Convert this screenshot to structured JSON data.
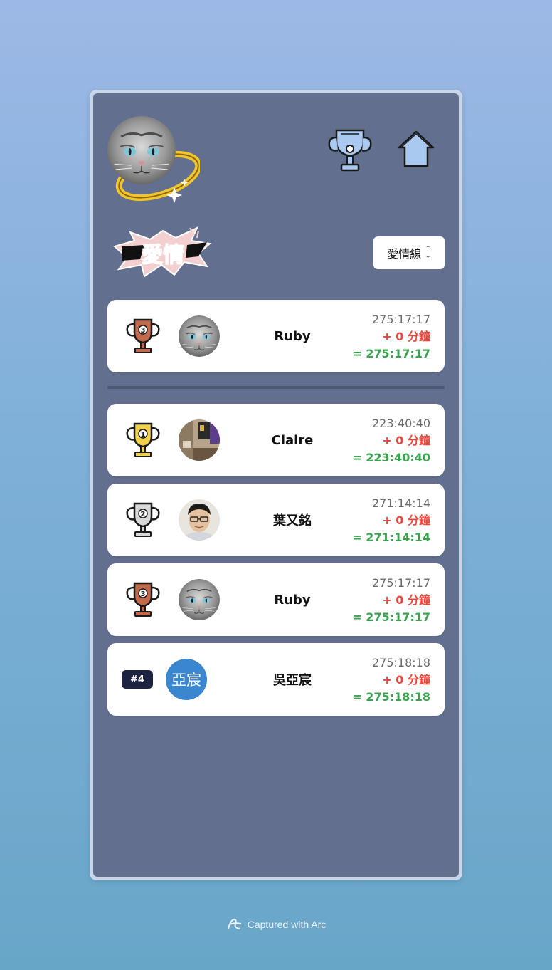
{
  "header": {
    "avatar_icon": "cat-avatar-with-halo",
    "trophy_button_icon": "trophy-icon",
    "home_button_icon": "home-icon",
    "logo_icon": "love-line-title-graphic"
  },
  "selector": {
    "selected": "愛情線"
  },
  "pinned": {
    "rank_icon": "bronze-trophy-3-icon",
    "name": "Ruby",
    "time": "275:17:17",
    "bonus": "+ 0 分鐘",
    "total": "= 275:17:17"
  },
  "leaderboard": [
    {
      "rank_icon": "gold-trophy-1-icon",
      "name": "Claire",
      "time": "223:40:40",
      "bonus": "+ 0 分鐘",
      "total": "= 223:40:40"
    },
    {
      "rank_icon": "silver-trophy-2-icon",
      "name": "葉又銘",
      "time": "271:14:14",
      "bonus": "+ 0 分鐘",
      "total": "= 271:14:14"
    },
    {
      "rank_icon": "bronze-trophy-3-icon",
      "name": "Ruby",
      "time": "275:17:17",
      "bonus": "+ 0 分鐘",
      "total": "= 275:17:17"
    },
    {
      "rank_label": "#4",
      "avatar_text": "亞宸",
      "name": "吳亞宸",
      "time": "275:18:18",
      "bonus": "+ 0 分鐘",
      "total": "= 275:18:18"
    }
  ],
  "footer": {
    "text": "Captured with Arc"
  },
  "colors": {
    "panel_bg": "#626f8e",
    "bonus_red": "#e8473d",
    "total_green": "#3aa34e",
    "gold": "#f1d04c",
    "silver": "#d8d8d8",
    "bronze": "#c2694b",
    "avatar_blue": "#3a87cf"
  }
}
